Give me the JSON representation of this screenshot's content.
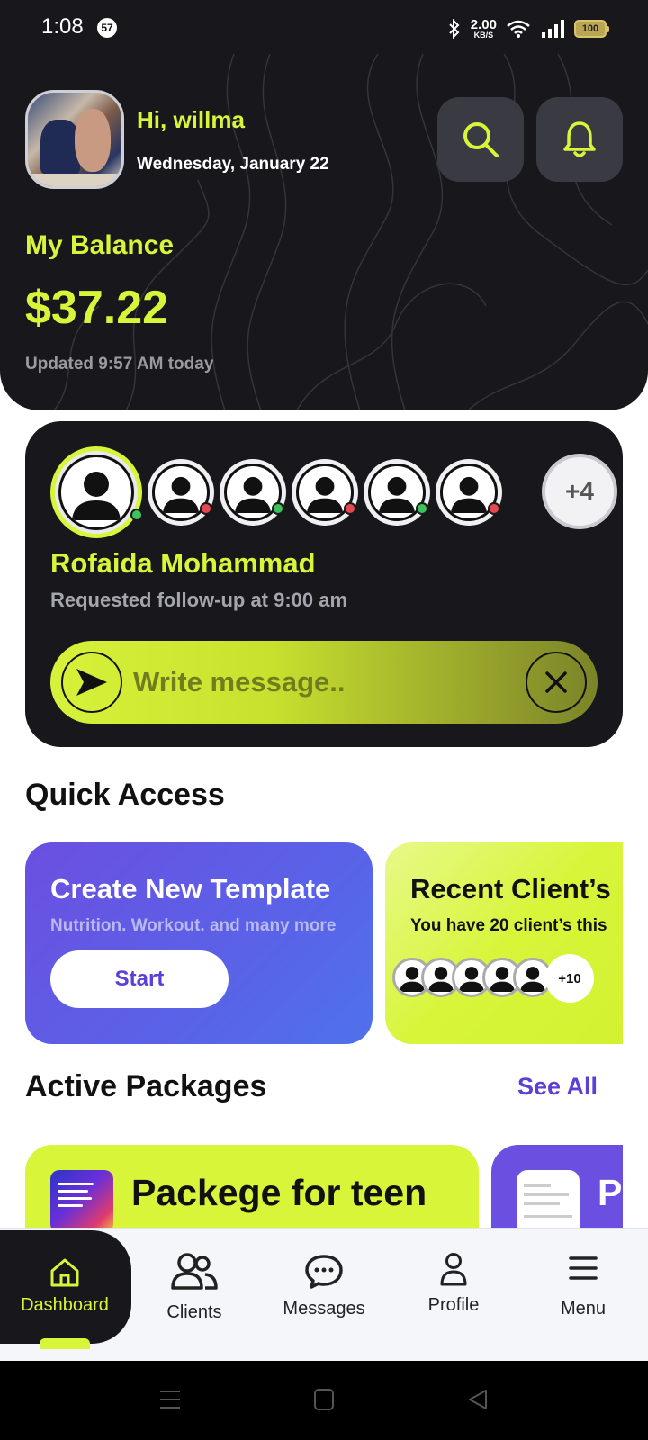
{
  "status_bar": {
    "time": "1:08",
    "notification_count": "57",
    "speed_value": "2.00",
    "speed_unit": "KB/S",
    "battery": "100"
  },
  "header": {
    "greeting": "Hi, willma",
    "date": "Wednesday, January 22",
    "balance_label": "My Balance",
    "balance_value": "$37.22",
    "balance_updated": "Updated 9:57 AM today"
  },
  "requests": {
    "more_count": "+4",
    "client_name": "Rofaida Mohammad",
    "request_text": "Requested follow-up at 9:00 am",
    "message_placeholder": "Write message..",
    "avatar_status": [
      "green",
      "red",
      "green",
      "red",
      "green",
      "red"
    ]
  },
  "quick_access": {
    "title": "Quick Access",
    "card1_title": "Create New Template",
    "card1_subtitle": "Nutrition. Workout. and many more",
    "card1_button": "Start",
    "card2_title": "Recent Client’s",
    "card2_subtitle": "You have 20 client’s this",
    "card2_more": "+10"
  },
  "packages": {
    "title": "Active Packages",
    "see_all": "See All",
    "package1_title": "Packege for teen",
    "package2_title": "P"
  },
  "nav": {
    "items": [
      {
        "label": "Dashboard",
        "icon": "home-icon"
      },
      {
        "label": "Clients",
        "icon": "users-icon"
      },
      {
        "label": "Messages",
        "icon": "chat-icon"
      },
      {
        "label": "Profile",
        "icon": "user-icon"
      },
      {
        "label": "Menu",
        "icon": "menu-icon"
      }
    ]
  },
  "colors": {
    "accent": "#d8f53a",
    "dark": "#17171c",
    "purple": "#5b3fd6"
  }
}
